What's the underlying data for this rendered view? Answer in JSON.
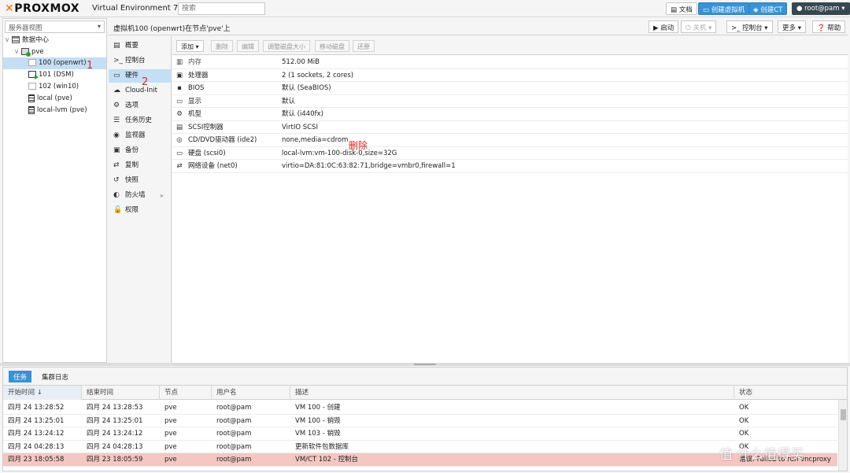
{
  "topbar": {
    "logo": "PROXMOX",
    "version": "Virtual Environment 7.1-7",
    "search_placeholder": "搜索",
    "docs_label": "文档",
    "create_vm_label": "创建虚拟机",
    "create_ct_label": "创建CT",
    "user_label": "root@pam"
  },
  "tree": {
    "view_select": "服务器视图",
    "items": [
      {
        "label": "数据中心"
      },
      {
        "label": "pve"
      },
      {
        "label": "100 (openwrt)"
      },
      {
        "label": "101 (DSM)"
      },
      {
        "label": "102 (win10)"
      },
      {
        "label": "local (pve)"
      },
      {
        "label": "local-lvm (pve)"
      }
    ]
  },
  "header": {
    "title": "虚拟机100 (openwrt)在节点'pve'上",
    "start_label": "启动",
    "shutdown_label": "关机",
    "console_label": "控制台",
    "more_label": "更多",
    "help_label": "帮助"
  },
  "submenu": {
    "items": [
      {
        "label": "概要"
      },
      {
        "label": "控制台"
      },
      {
        "label": "硬件"
      },
      {
        "label": "Cloud-Init"
      },
      {
        "label": "选项"
      },
      {
        "label": "任务历史"
      },
      {
        "label": "监视器"
      },
      {
        "label": "备份"
      },
      {
        "label": "复制"
      },
      {
        "label": "快照"
      },
      {
        "label": "防火墙"
      },
      {
        "label": "权限"
      }
    ]
  },
  "hardware": {
    "toolbar": {
      "add": "添加",
      "remove": "删除",
      "edit": "编辑",
      "resize": "调整磁盘大小",
      "move": "移动磁盘",
      "revert": "还原"
    },
    "rows": [
      {
        "name": "内存",
        "value": "512.00 MiB"
      },
      {
        "name": "处理器",
        "value": "2 (1 sockets, 2 cores)"
      },
      {
        "name": "BIOS",
        "value": "默认 (SeaBIOS)"
      },
      {
        "name": "显示",
        "value": "默认"
      },
      {
        "name": "机型",
        "value": "默认 (i440fx)"
      },
      {
        "name": "SCSI控制器",
        "value": "VirtIO SCSI"
      },
      {
        "name": "CD/DVD驱动器 (ide2)",
        "value": "none,media=cdrom"
      },
      {
        "name": "硬盘 (scsi0)",
        "value": "local-lvm:vm-100-disk-0,size=32G"
      },
      {
        "name": "网络设备 (net0)",
        "value": "virtio=DA:81:0C:63:82:71,bridge=vmbr0,firewall=1"
      }
    ]
  },
  "annotations": {
    "one": "1",
    "two": "2",
    "delete": "删除"
  },
  "tasks": {
    "tabs": {
      "tasks": "任务",
      "cluster_log": "集群日志"
    },
    "columns": {
      "start": "开始时间 ↓",
      "end": "结束时间",
      "node": "节点",
      "user": "用户名",
      "desc": "描述",
      "status": "状态"
    },
    "rows": [
      {
        "start": "四月 24 13:28:52",
        "end": "四月 24 13:28:53",
        "node": "pve",
        "user": "root@pam",
        "desc": "VM 100 - 创建",
        "status": "OK"
      },
      {
        "start": "四月 24 13:25:01",
        "end": "四月 24 13:25:01",
        "node": "pve",
        "user": "root@pam",
        "desc": "VM 100 - 销毁",
        "status": "OK"
      },
      {
        "start": "四月 24 13:24:12",
        "end": "四月 24 13:24:12",
        "node": "pve",
        "user": "root@pam",
        "desc": "VM 103 - 销毁",
        "status": "OK"
      },
      {
        "start": "四月 24 04:28:13",
        "end": "四月 24 04:28:13",
        "node": "pve",
        "user": "root@pam",
        "desc": "更新软件包数据库",
        "status": "OK"
      },
      {
        "start": "四月 23 18:05:58",
        "end": "四月 23 18:05:59",
        "node": "pve",
        "user": "root@pam",
        "desc": "VM/CT 102 - 控制台",
        "status": "错误: Failed to run vncproxy"
      }
    ]
  },
  "watermark": "值 什么值得买"
}
